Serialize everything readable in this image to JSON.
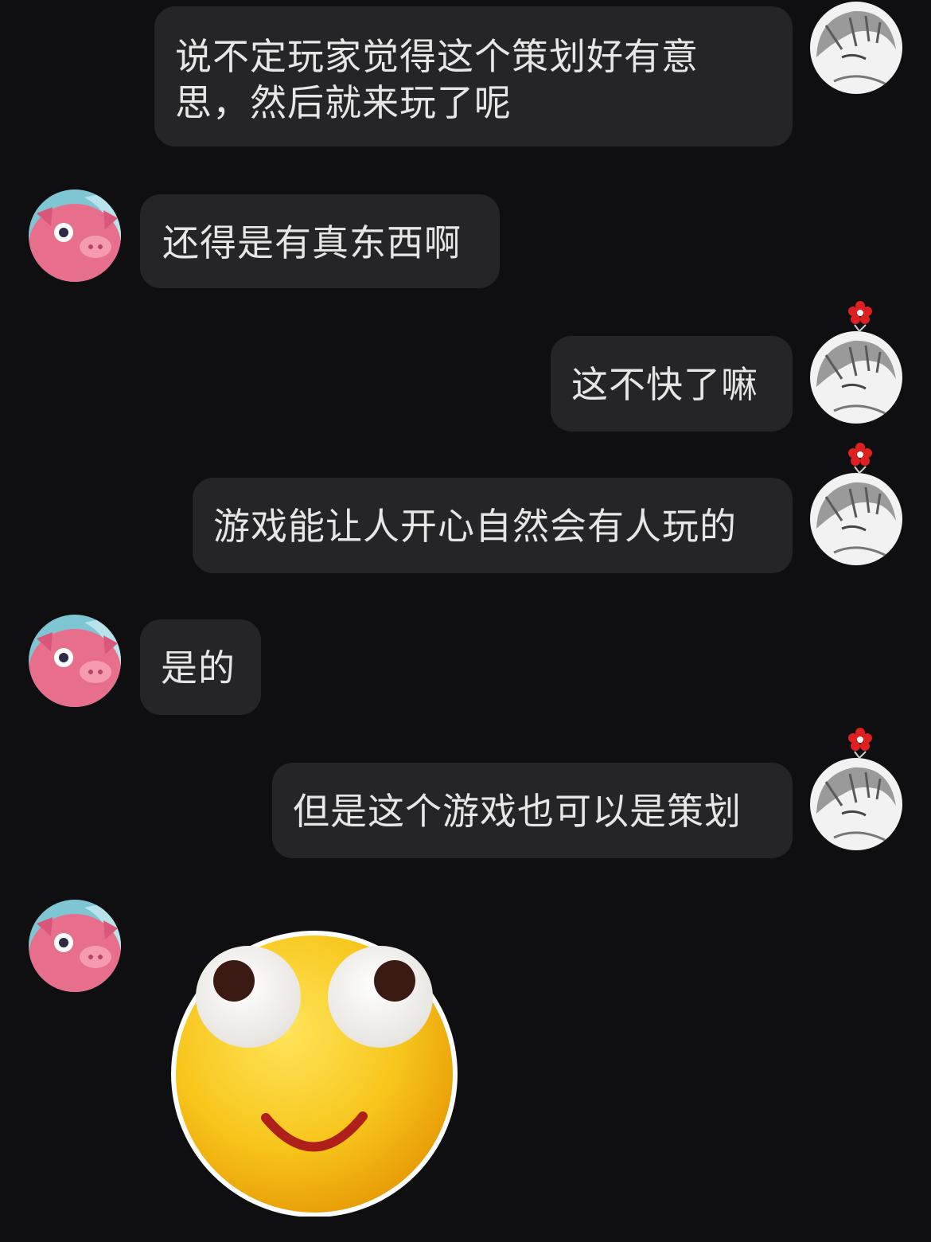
{
  "chat": {
    "messages": [
      {
        "sender": "me",
        "text_line1": "说不定玩家觉得这个策划好有意",
        "text_line2": "思，然后就来玩了呢"
      },
      {
        "sender": "other",
        "text": "还得是有真东西啊"
      },
      {
        "sender": "me",
        "text": "这不快了嘛"
      },
      {
        "sender": "me",
        "text": "游戏能让人开心自然会有人玩的"
      },
      {
        "sender": "other",
        "text": "是的"
      },
      {
        "sender": "me",
        "text": "但是这个游戏也可以是策划"
      },
      {
        "sender": "other",
        "sticker": "rolling-eyes-smiley-sticker"
      }
    ]
  },
  "icons": {
    "self_avatar": "anime-character-avatar",
    "other_avatar": "pink-pig-avatar",
    "badge": "red-flower-badge"
  },
  "colors": {
    "background": "#0f0f11",
    "bubble": "#252527",
    "text": "#e6e6e6"
  }
}
